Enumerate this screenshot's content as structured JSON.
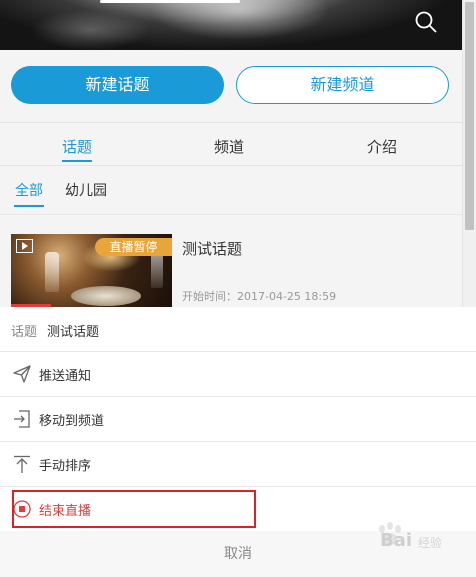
{
  "buttons": {
    "new_topic": "新建话题",
    "new_channel": "新建频道"
  },
  "tabs": [
    "话题",
    "频道",
    "介绍"
  ],
  "categories": [
    "全部",
    "幼儿园"
  ],
  "topic_card": {
    "badge": "直播暂停",
    "title": "测试话题",
    "start_time": "开始时间：2017-04-25 18:59"
  },
  "sheet": {
    "header_key": "话题",
    "header_value": "测试话题",
    "actions": [
      "推送通知",
      "移动到频道",
      "手动排序",
      "结束直播"
    ],
    "cancel": "取消"
  },
  "watermark": {
    "text": "Bai",
    "sub": "经验"
  },
  "colors": {
    "accent": "#1a9ad6",
    "danger": "#e23c3c",
    "badge": "#e7a53a"
  }
}
